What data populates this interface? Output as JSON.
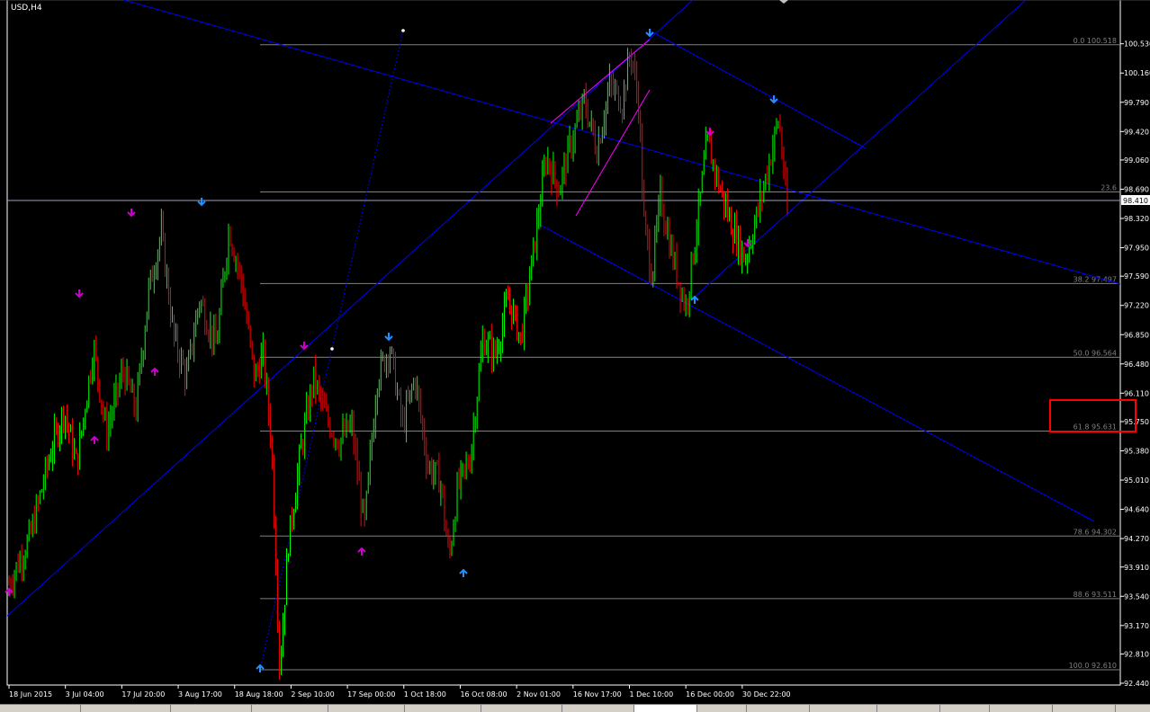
{
  "window": {
    "symbol_timeframe": "USD,H4"
  },
  "colors": {
    "background": "#000000",
    "axis": "#ffffff",
    "grid_fib": "#808080",
    "trendline": "#0000ff",
    "wedge": "#ff00ff",
    "candle_up": "#00ff00",
    "candle_down": "#ff0000",
    "arrow_blue": "#1e90ff",
    "arrow_magenta": "#cc00cc",
    "highlight_box": "#ff0000",
    "price_label_bg": "#ffffff"
  },
  "chart_data": {
    "type": "line",
    "title": "USD,H4",
    "ylim": [
      92.44,
      100.72
    ],
    "y_ticks": [
      "100.530",
      "100.160",
      "99.790",
      "99.420",
      "99.060",
      "98.690",
      "98.320",
      "97.950",
      "97.590",
      "97.220",
      "96.850",
      "96.480",
      "96.110",
      "95.750",
      "95.380",
      "95.010",
      "94.640",
      "94.270",
      "93.910",
      "93.540",
      "93.170",
      "92.810",
      "92.440"
    ],
    "x_ticks": [
      "18 Jun 2015",
      "3 Jul 04:00",
      "17 Jul 20:00",
      "3 Aug 17:00",
      "18 Aug 18:00",
      "2 Sep 10:00",
      "17 Sep 00:00",
      "1 Oct 18:00",
      "16 Oct 08:00",
      "2 Nov 01:00",
      "16 Nov 17:00",
      "1 Dec 10:00",
      "16 Dec 00:00",
      "30 Dec 22:00"
    ],
    "current_price": "98.410",
    "fibonacci_levels": [
      {
        "label": "0.0 100.518",
        "price": 100.518
      },
      {
        "label": "23.6",
        "price": 98.655
      },
      {
        "label": "38.2 97.497",
        "price": 97.497
      },
      {
        "label": "50.0 96.564",
        "price": 96.564
      },
      {
        "label": "61.8 95.631",
        "price": 95.631
      },
      {
        "label": "78.6 94.302",
        "price": 94.302
      },
      {
        "label": "88.6 93.511",
        "price": 93.511
      },
      {
        "label": "100.0 92.610",
        "price": 92.61
      }
    ],
    "price_path": [
      {
        "x": 0.0,
        "y": 93.7
      },
      {
        "x": 0.5,
        "y": 94.3
      },
      {
        "x": 1.0,
        "y": 95.4
      },
      {
        "x": 1.3,
        "y": 95.9
      },
      {
        "x": 1.6,
        "y": 95.2
      },
      {
        "x": 2.0,
        "y": 96.7
      },
      {
        "x": 2.3,
        "y": 95.6
      },
      {
        "x": 2.7,
        "y": 96.4
      },
      {
        "x": 3.0,
        "y": 95.9
      },
      {
        "x": 3.3,
        "y": 97.4
      },
      {
        "x": 3.6,
        "y": 98.15
      },
      {
        "x": 3.9,
        "y": 96.8
      },
      {
        "x": 4.2,
        "y": 96.3
      },
      {
        "x": 4.5,
        "y": 97.3
      },
      {
        "x": 4.9,
        "y": 96.7
      },
      {
        "x": 5.2,
        "y": 98.2
      },
      {
        "x": 5.5,
        "y": 97.5
      },
      {
        "x": 5.8,
        "y": 96.3
      },
      {
        "x": 6.0,
        "y": 96.6
      },
      {
        "x": 6.2,
        "y": 95.5
      },
      {
        "x": 6.4,
        "y": 92.61
      },
      {
        "x": 6.6,
        "y": 94.2
      },
      {
        "x": 6.9,
        "y": 95.4
      },
      {
        "x": 7.2,
        "y": 96.3
      },
      {
        "x": 7.5,
        "y": 95.8
      },
      {
        "x": 7.8,
        "y": 95.5
      },
      {
        "x": 8.1,
        "y": 95.7
      },
      {
        "x": 8.4,
        "y": 94.4
      },
      {
        "x": 8.7,
        "y": 96.3
      },
      {
        "x": 9.0,
        "y": 96.7
      },
      {
        "x": 9.3,
        "y": 95.7
      },
      {
        "x": 9.6,
        "y": 96.3
      },
      {
        "x": 9.9,
        "y": 95.2
      },
      {
        "x": 10.2,
        "y": 95.0
      },
      {
        "x": 10.4,
        "y": 94.0
      },
      {
        "x": 10.6,
        "y": 94.9
      },
      {
        "x": 10.9,
        "y": 95.3
      },
      {
        "x": 11.2,
        "y": 96.8
      },
      {
        "x": 11.5,
        "y": 96.6
      },
      {
        "x": 11.8,
        "y": 97.3
      },
      {
        "x": 12.1,
        "y": 96.8
      },
      {
        "x": 12.4,
        "y": 97.9
      },
      {
        "x": 12.7,
        "y": 99.1
      },
      {
        "x": 13.0,
        "y": 98.7
      },
      {
        "x": 13.3,
        "y": 99.3
      },
      {
        "x": 13.6,
        "y": 99.8
      },
      {
        "x": 13.9,
        "y": 99.2
      },
      {
        "x": 14.2,
        "y": 100.0
      },
      {
        "x": 14.5,
        "y": 99.8
      },
      {
        "x": 14.7,
        "y": 100.45
      },
      {
        "x": 14.9,
        "y": 99.7
      },
      {
        "x": 15.0,
        "y": 98.3
      },
      {
        "x": 15.2,
        "y": 97.6
      },
      {
        "x": 15.4,
        "y": 98.6
      },
      {
        "x": 15.7,
        "y": 97.8
      },
      {
        "x": 16.0,
        "y": 97.2
      },
      {
        "x": 16.3,
        "y": 98.4
      },
      {
        "x": 16.5,
        "y": 99.3
      },
      {
        "x": 16.8,
        "y": 98.7
      },
      {
        "x": 17.1,
        "y": 98.2
      },
      {
        "x": 17.4,
        "y": 97.8
      },
      {
        "x": 17.7,
        "y": 98.4
      },
      {
        "x": 18.0,
        "y": 99.1
      },
      {
        "x": 18.2,
        "y": 99.6
      },
      {
        "x": 18.4,
        "y": 98.4
      }
    ],
    "annotations": {
      "arrows_down": [
        "3 Jul 04:00 area",
        "3 Aug 17:00 area",
        "2 Sep 10:00 area",
        "17 Sep 00:00 area",
        "1 Dec 10:00 area",
        "16 Dec 00:00 area",
        "30 Dec 22:00 area"
      ],
      "arrows_up": [
        "18 Jun 2015 area",
        "3 Jul 04:00 area",
        "17 Jul 20:00 area",
        "18 Aug 18:00 area",
        "17 Sep 00:00 area",
        "16 Oct 08:00 area",
        "16 Dec 00:00 area"
      ]
    },
    "grid": false,
    "legend": "none"
  },
  "bottom_tabs": [
    "",
    "",
    "",
    "",
    "",
    "",
    "",
    "",
    "",
    "",
    "",
    "",
    "",
    "",
    "",
    "",
    "",
    "",
    "",
    "",
    ""
  ]
}
